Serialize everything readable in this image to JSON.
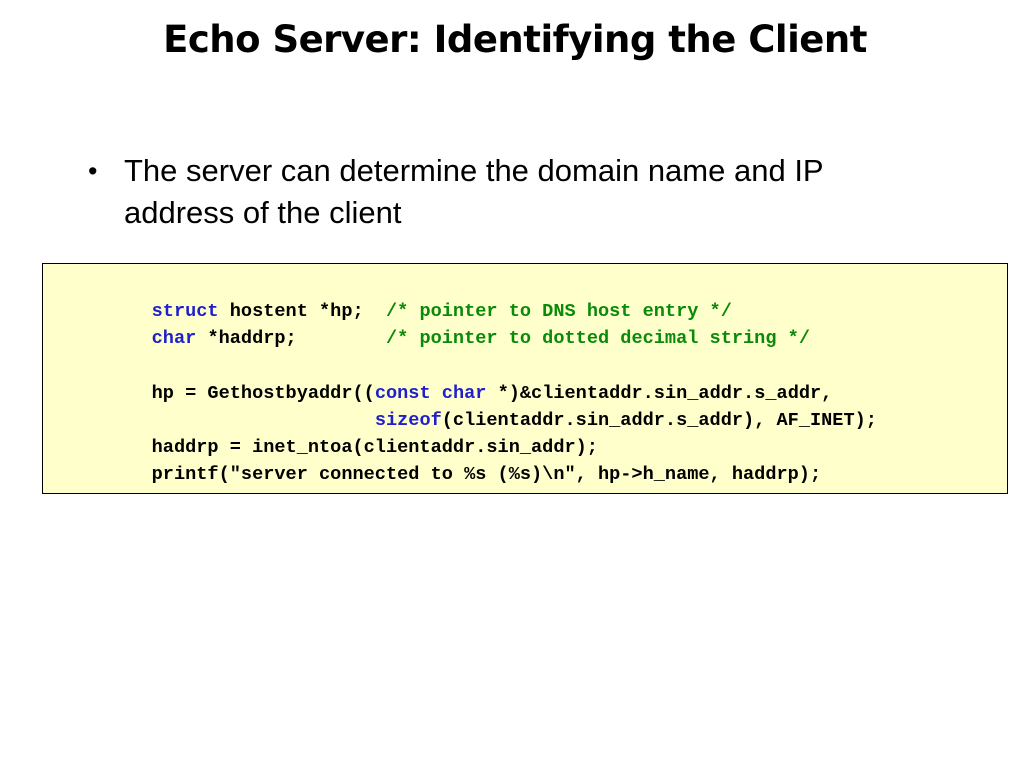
{
  "slide": {
    "title": "Echo Server: Identifying the Client"
  },
  "bullets": [
    {
      "marker": "•",
      "text_line1": "The server can determine the domain name and IP",
      "text_line2": "address of the client"
    }
  ],
  "code": {
    "lines": [
      [
        {
          "t": "struct",
          "k": "kw"
        },
        {
          "t": " hostent *hp;  ",
          "k": "tx"
        },
        {
          "t": "/* pointer to DNS host entry */",
          "k": "cm"
        }
      ],
      [
        {
          "t": "char",
          "k": "kw"
        },
        {
          "t": " *haddrp;        ",
          "k": "tx"
        },
        {
          "t": "/* pointer to dotted decimal string */",
          "k": "cm"
        }
      ],
      [
        {
          "t": "",
          "k": "tx"
        }
      ],
      [
        {
          "t": "hp = Gethostbyaddr((",
          "k": "tx"
        },
        {
          "t": "const",
          "k": "kw"
        },
        {
          "t": " ",
          "k": "tx"
        },
        {
          "t": "char",
          "k": "kw"
        },
        {
          "t": " *)&clientaddr.sin_addr.s_addr,",
          "k": "tx"
        }
      ],
      [
        {
          "t": "                    ",
          "k": "tx"
        },
        {
          "t": "sizeof",
          "k": "kw"
        },
        {
          "t": "(clientaddr.sin_addr.s_addr), AF_INET);",
          "k": "tx"
        }
      ],
      [
        {
          "t": "haddrp = inet_ntoa(clientaddr.sin_addr);",
          "k": "tx"
        }
      ],
      [
        {
          "t": "printf(\"server connected to %s (%s)\\n\", hp->h_name, haddrp);",
          "k": "tx"
        }
      ]
    ]
  },
  "colors": {
    "code_background": "#ffffcc",
    "keyword": "#1f1fcc",
    "comment": "#0a8a0a",
    "text": "#000000"
  }
}
